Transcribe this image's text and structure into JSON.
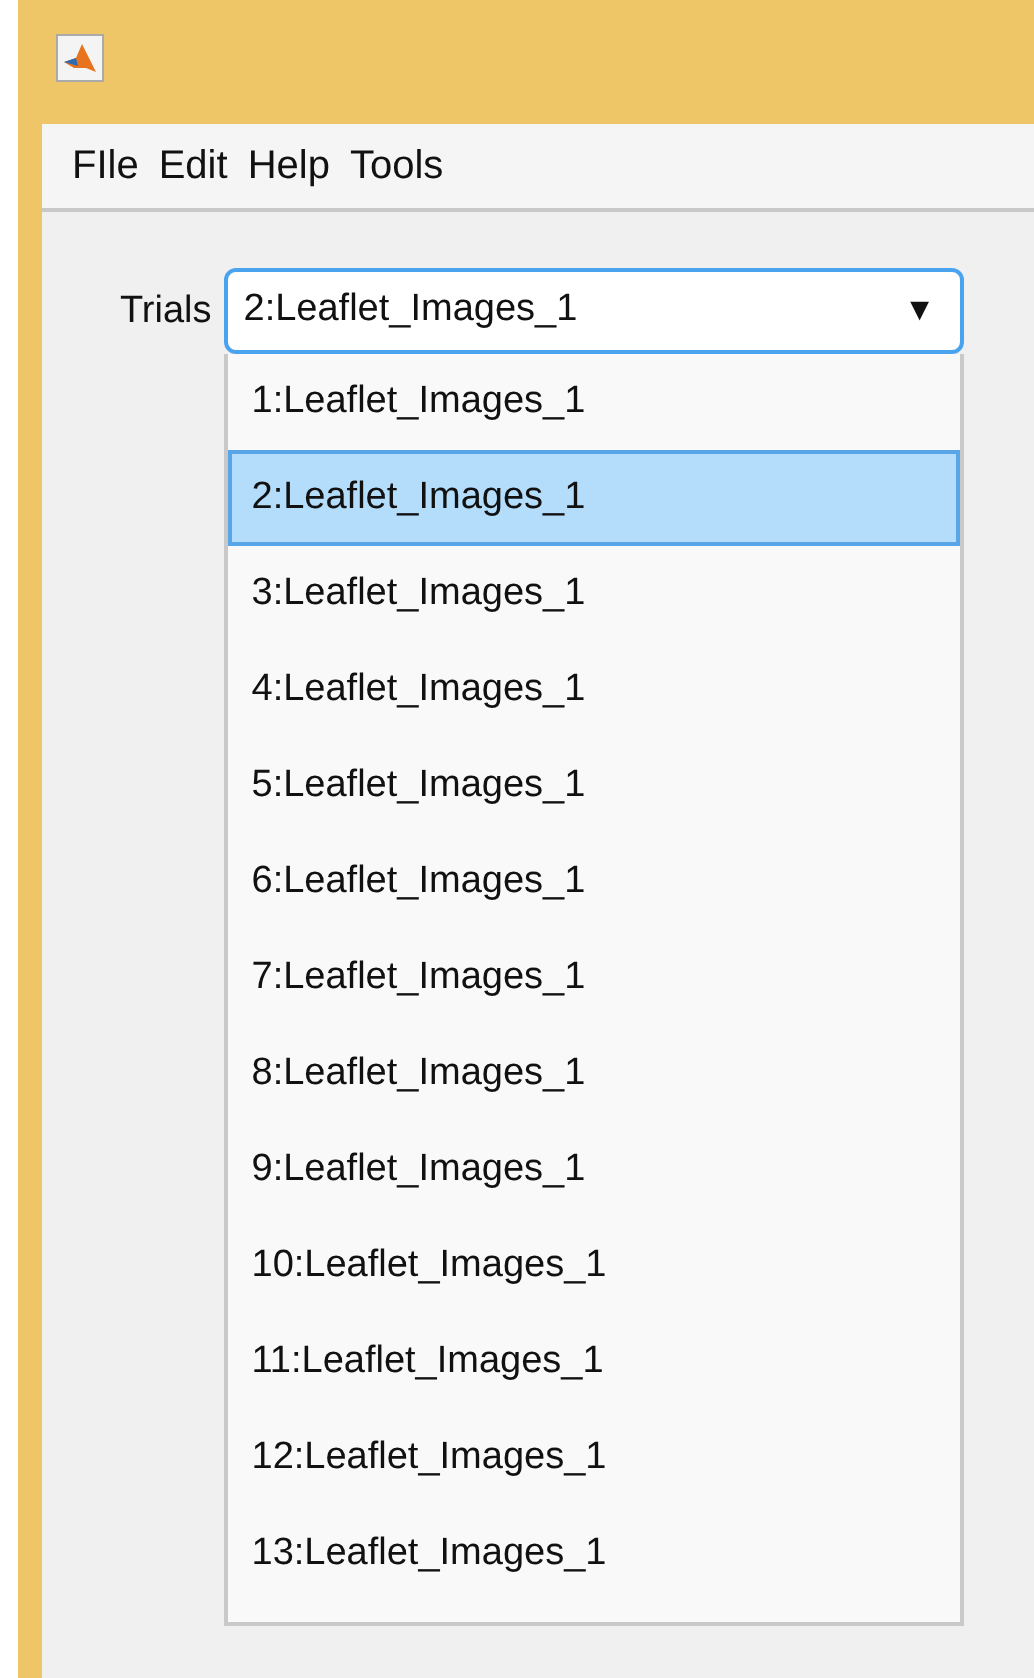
{
  "menu": [
    "FIle",
    "Edit",
    "Help",
    "Tools"
  ],
  "trials": {
    "label": "Trials",
    "value": "2:Leaflet_Images_1",
    "arrow": "▼",
    "expanded": true,
    "options": [
      {
        "label": "1:Leaflet_Images_1",
        "selected": false
      },
      {
        "label": "2:Leaflet_Images_1",
        "selected": true
      },
      {
        "label": "3:Leaflet_Images_1",
        "selected": false
      },
      {
        "label": "4:Leaflet_Images_1",
        "selected": false
      },
      {
        "label": "5:Leaflet_Images_1",
        "selected": false
      },
      {
        "label": "6:Leaflet_Images_1",
        "selected": false
      },
      {
        "label": "7:Leaflet_Images_1",
        "selected": false
      },
      {
        "label": "8:Leaflet_Images_1",
        "selected": false
      },
      {
        "label": "9:Leaflet_Images_1",
        "selected": false
      },
      {
        "label": "10:Leaflet_Images_1",
        "selected": false
      },
      {
        "label": "11:Leaflet_Images_1",
        "selected": false
      },
      {
        "label": "12:Leaflet_Images_1",
        "selected": false
      },
      {
        "label": "13:Leaflet_Images_1",
        "selected": false
      }
    ]
  }
}
